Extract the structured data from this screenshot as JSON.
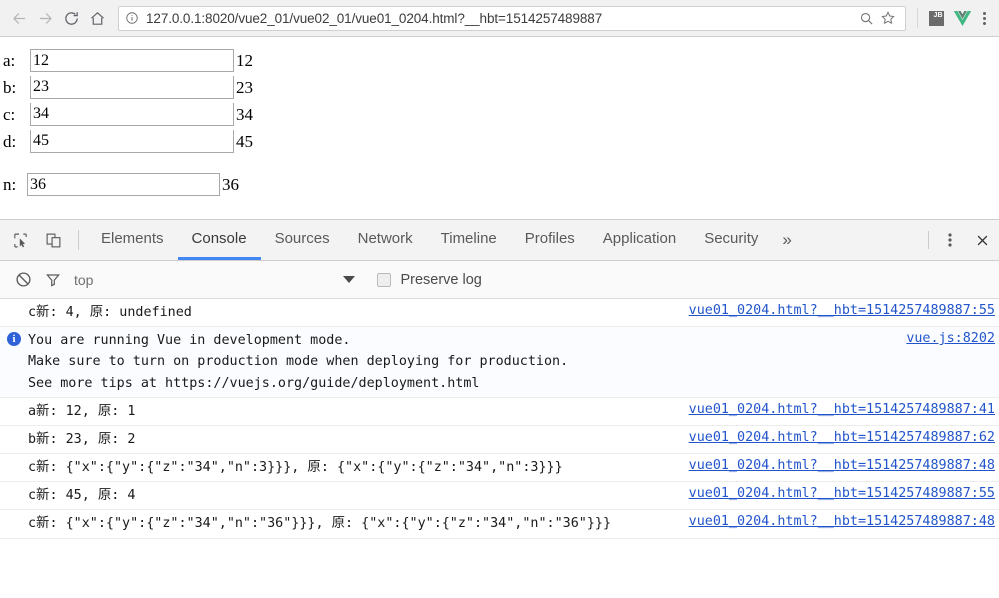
{
  "browser": {
    "nav": {
      "back": "back-arrow",
      "forward": "forward-arrow",
      "reload": "reload",
      "home": "home"
    },
    "omnibox": {
      "info_icon": "page-info-icon",
      "url_host": "127.0.0.1",
      "url_rest": ":8020/vue2_01/vue02_01/vue01_0204.html?__hbt=1514257489887",
      "url_full": "127.0.0.1:8020/vue2_01/vue02_01/vue01_0204.html?__hbt=1514257489887",
      "zoom_icon": "zoom-magnifier-icon",
      "bookmark_icon": "star-icon"
    },
    "extensions": [
      {
        "name": "jetbrains-extension-icon",
        "label": "JB"
      },
      {
        "name": "vue-devtools-icon",
        "label": "V",
        "color": "#41b883"
      }
    ],
    "menu_icon": "three-dots-menu-icon"
  },
  "page": {
    "fields": [
      {
        "label": "a:",
        "value": "12",
        "output": "12"
      },
      {
        "label": "b:",
        "value": "23",
        "output": "23"
      },
      {
        "label": "c:",
        "value": "34",
        "output": "34"
      },
      {
        "label": "d:",
        "value": "45",
        "output": "45"
      }
    ],
    "n_field": {
      "label": "n:",
      "value": "36",
      "output": "36"
    }
  },
  "devtools": {
    "inspect_icon": "inspect-element-icon",
    "device_icon": "device-toolbar-icon",
    "tabs": [
      {
        "label": "Elements",
        "active": false
      },
      {
        "label": "Console",
        "active": true
      },
      {
        "label": "Sources",
        "active": false
      },
      {
        "label": "Network",
        "active": false
      },
      {
        "label": "Timeline",
        "active": false
      },
      {
        "label": "Profiles",
        "active": false
      },
      {
        "label": "Application",
        "active": false
      },
      {
        "label": "Security",
        "active": false
      }
    ],
    "more_tabs": "»",
    "settings_icon": "three-dots-vertical-icon",
    "close_icon": "close-icon",
    "accent_color": "#4285f4",
    "filterbar": {
      "clear_icon": "clear-console-icon",
      "filter_icon": "filter-funnel-icon",
      "context": "top",
      "dropdown_icon": "chevron-down-icon",
      "preserve_log_checked": false,
      "preserve_log_label": "Preserve log"
    },
    "console_rows": [
      {
        "level": "log",
        "message": "c新: 4, 原: undefined",
        "source": "vue01_0204.html?__hbt=1514257489887:55"
      },
      {
        "level": "info",
        "message": "You are running Vue in development mode.\nMake sure to turn on production mode when deploying for production.\nSee more tips at https://vuejs.org/guide/deployment.html",
        "source": "vue.js:8202"
      },
      {
        "level": "log",
        "message": "a新: 12, 原: 1",
        "source": "vue01_0204.html?__hbt=1514257489887:41"
      },
      {
        "level": "log",
        "message": "b新: 23, 原: 2",
        "source": "vue01_0204.html?__hbt=1514257489887:62"
      },
      {
        "level": "log",
        "message": "c新: {\"x\":{\"y\":{\"z\":\"34\",\"n\":3}}}, 原: {\"x\":{\"y\":{\"z\":\"34\",\"n\":3}}}",
        "source": "vue01_0204.html?__hbt=1514257489887:48"
      },
      {
        "level": "log",
        "message": "c新: 45, 原: 4",
        "source": "vue01_0204.html?__hbt=1514257489887:55"
      },
      {
        "level": "log",
        "message": "c新: {\"x\":{\"y\":{\"z\":\"34\",\"n\":\"36\"}}}, 原: {\"x\":{\"y\":{\"z\":\"34\",\"n\":\"36\"}}}",
        "source": "vue01_0204.html?__hbt=1514257489887:48"
      }
    ]
  }
}
